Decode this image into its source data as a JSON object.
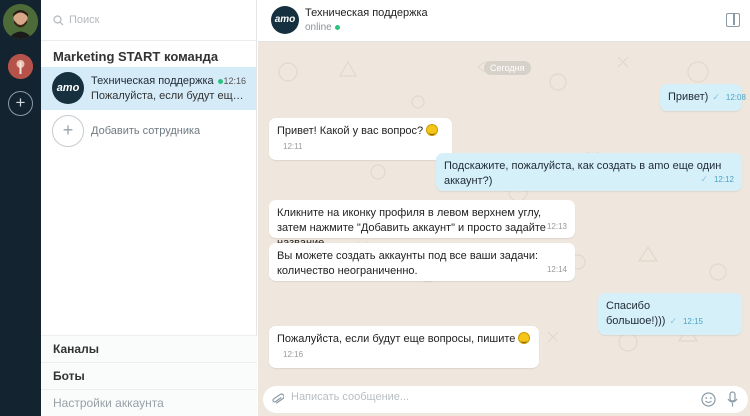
{
  "sidebar": {
    "search_placeholder": "Поиск",
    "team_title": "Marketing START команда",
    "chat": {
      "avatar_text": "amo",
      "name": "Техническая поддержка",
      "time": "12:16",
      "preview": "Пожалуйста, если будут еще вопросы, пишите"
    },
    "add_employee": "Добавить сотрудника",
    "links": {
      "channels": "Каналы",
      "bots": "Боты",
      "settings": "Настройки аккаунта"
    }
  },
  "header": {
    "avatar_text": "amo",
    "title": "Техническая поддержка",
    "status": "online"
  },
  "day_label": "Сегодня",
  "messages": [
    {
      "dir": "out",
      "text": "Привет)",
      "time": "12:08"
    },
    {
      "dir": "in",
      "text": "Привет! Какой у вас вопрос?",
      "time": "12:11"
    },
    {
      "dir": "out",
      "text": "Подскажите, пожалуйста, как создать в amo еще один аккаунт?)",
      "time": "12:12"
    },
    {
      "dir": "in",
      "text": "Кликните на иконку профиля в левом верхнем углу, затем нажмите \"Добавить аккаунт\" и просто задайте название.",
      "time": "12:13"
    },
    {
      "dir": "in",
      "text": "Вы можете создать аккаунты под все ваши задачи: количество неограниченно.",
      "time": "12:14"
    },
    {
      "dir": "out",
      "text": "Спасибо большое!)))",
      "time": "12:15"
    },
    {
      "dir": "in",
      "text": "Пожалуйста, если будут еще вопросы, пишите",
      "time": "12:16"
    }
  ],
  "composer": {
    "placeholder": "Написать сообщение..."
  },
  "colors": {
    "rail": "#13232f",
    "accent": "#2ec27e",
    "out_bubble": "#d6f0fa",
    "chat_bg": "#efe7dd"
  }
}
